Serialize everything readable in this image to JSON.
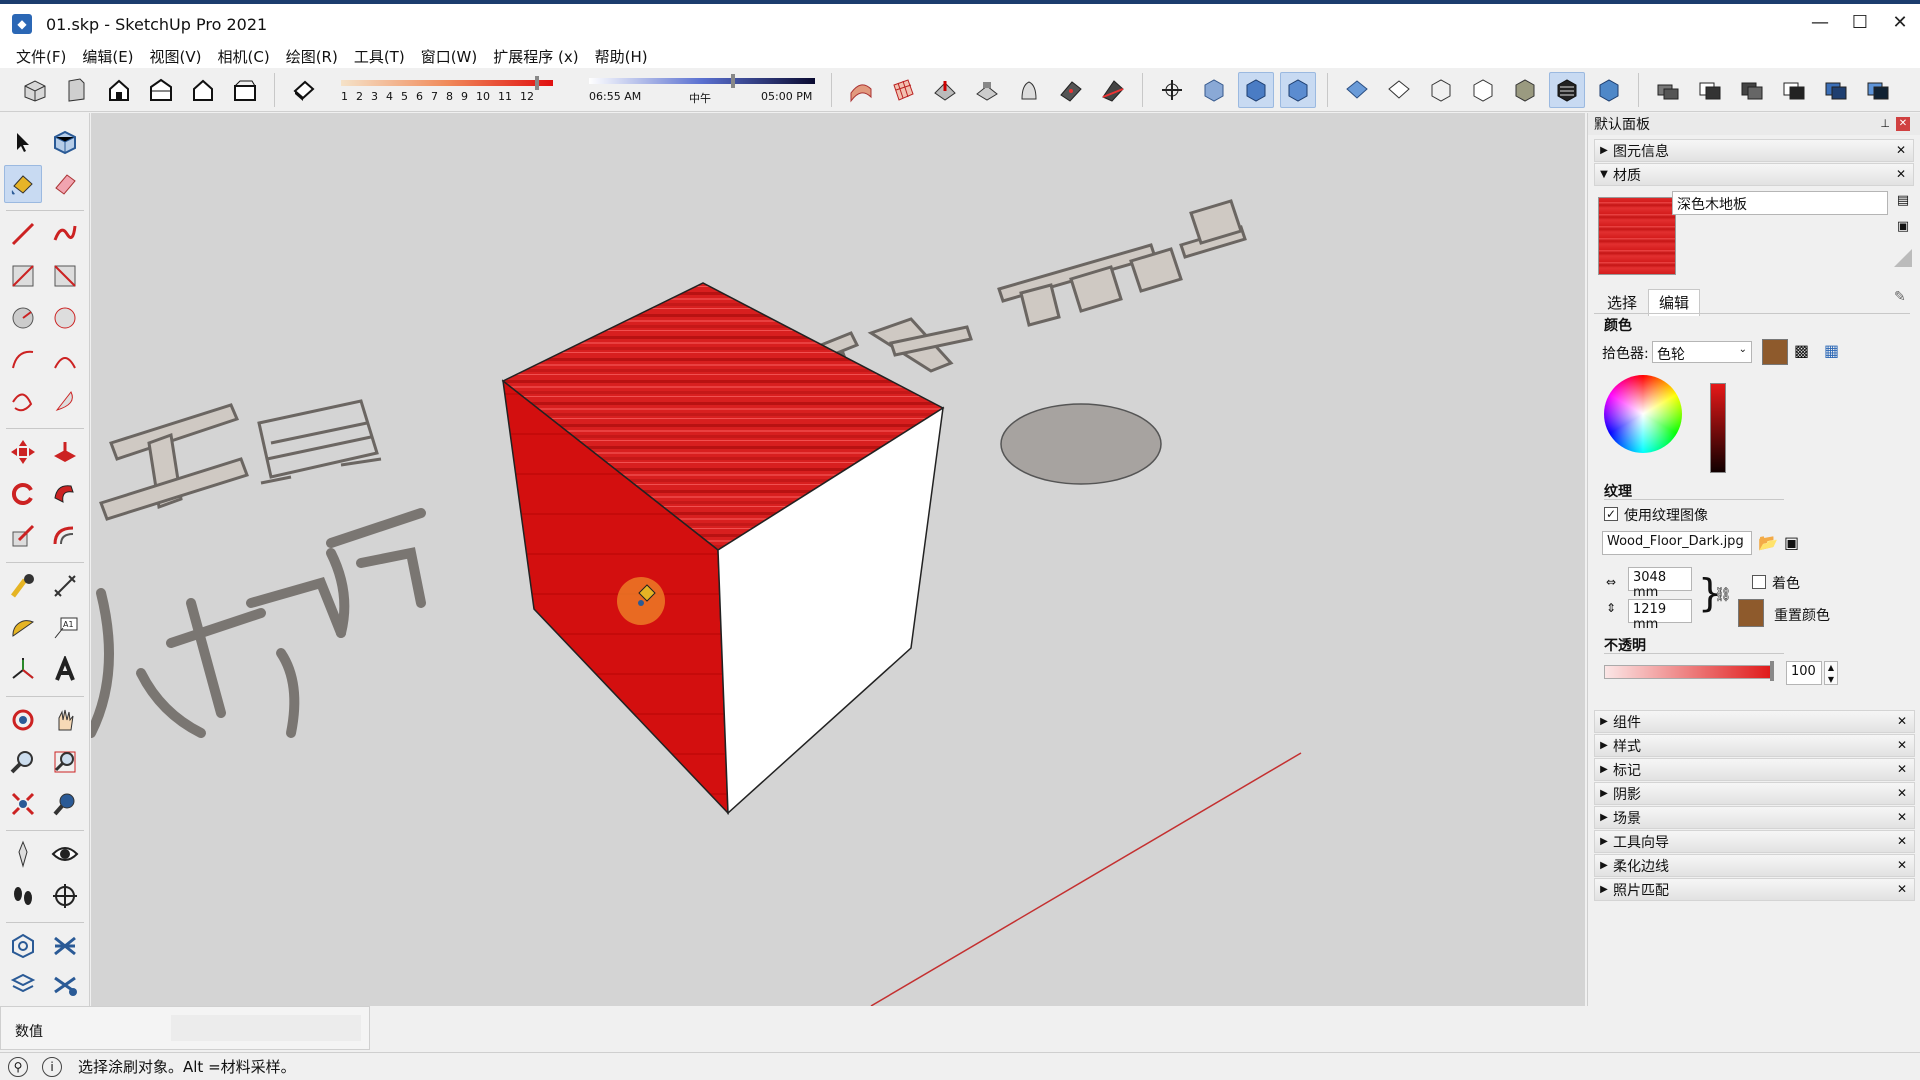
{
  "window": {
    "title": "01.skp - SketchUp Pro 2021",
    "minimize": "—",
    "maximize": "☐",
    "close": "✕"
  },
  "menu": [
    "文件(F)",
    "编辑(E)",
    "视图(V)",
    "相机(C)",
    "绘图(R)",
    "工具(T)",
    "窗口(W)",
    "扩展程序 (x)",
    "帮助(H)"
  ],
  "shadow": {
    "months": [
      "1",
      "2",
      "3",
      "4",
      "5",
      "6",
      "7",
      "8",
      "9",
      "10",
      "11",
      "12"
    ],
    "time_start": "06:55 AM",
    "time_mid": "中午",
    "time_end": "05:00 PM"
  },
  "viewport": {
    "text_tools": "工具",
    "text_material": "材质",
    "text_panel": "面板",
    "text_default": "默认面板"
  },
  "tray": {
    "title": "默认面板",
    "entity_info": "图元信息",
    "materials": "材质",
    "material_name": "深色木地板",
    "tab_select": "选择",
    "tab_edit": "编辑",
    "color_section": "颜色",
    "picker_label": "拾色器:",
    "picker_value": "色轮",
    "texture_section": "纹理",
    "use_texture": "使用纹理图像",
    "texture_file": "Wood_Floor_Dark.jpg",
    "width": "3048 mm",
    "height": "1219 mm",
    "colorize": "着色",
    "reset_color": "重置颜色",
    "opacity_section": "不透明",
    "opacity_value": "100",
    "collapsed": [
      "组件",
      "样式",
      "标记",
      "阴影",
      "场景",
      "工具向导",
      "柔化边线",
      "照片匹配"
    ]
  },
  "measurements": {
    "label": "数值",
    "value": ""
  },
  "status": {
    "text": "选择涂刷对象。Alt =材料采样。"
  },
  "colors": {
    "material": "#d41c1c",
    "swatch": "#8e5a2c",
    "accent": "#2b67b5"
  }
}
